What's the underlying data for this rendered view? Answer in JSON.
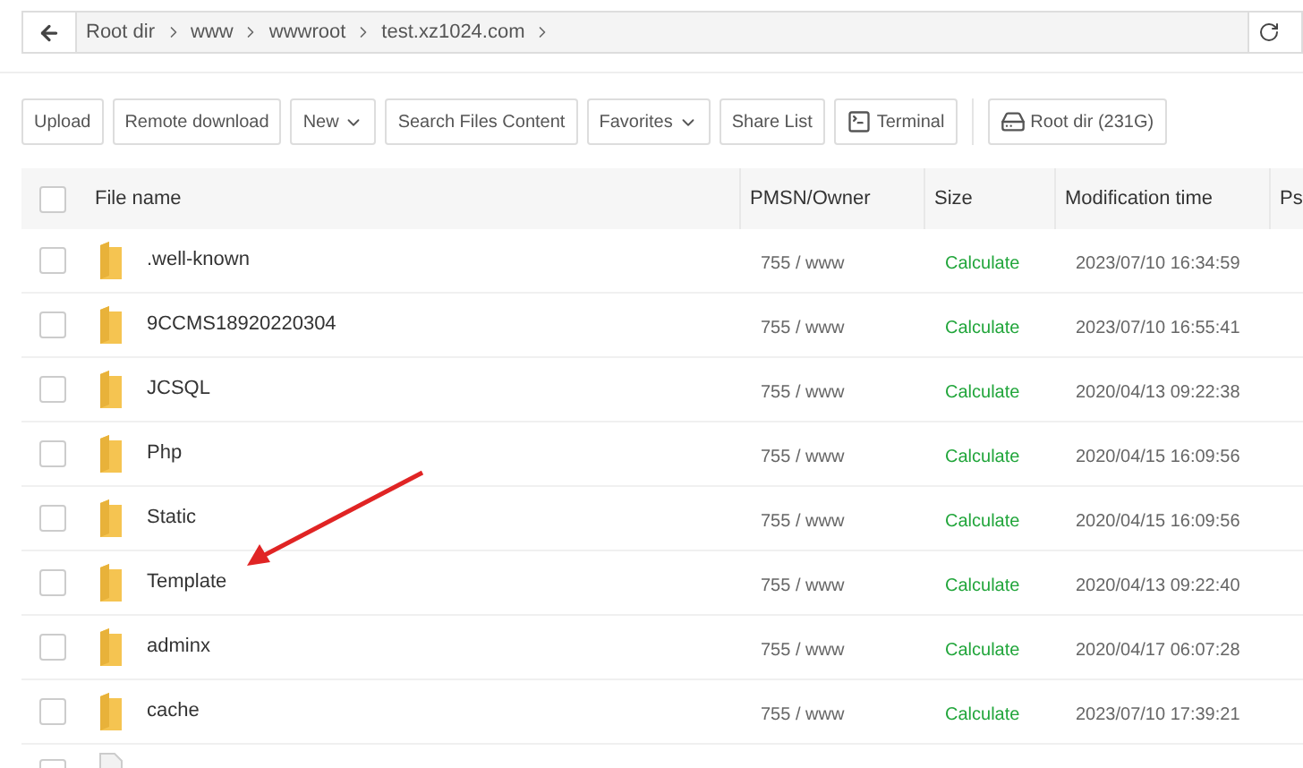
{
  "breadcrumb": [
    "Root dir",
    "www",
    "wwwroot",
    "test.xz1024.com"
  ],
  "toolbar": [
    {
      "label": "Upload",
      "kind": "plain"
    },
    {
      "label": "Remote download",
      "kind": "plain"
    },
    {
      "label": "New",
      "kind": "dropdown"
    },
    {
      "label": "Search Files Content",
      "kind": "plain"
    },
    {
      "label": "Favorites",
      "kind": "dropdown"
    },
    {
      "label": "Share List",
      "kind": "plain"
    },
    {
      "label": "Terminal",
      "kind": "terminal"
    },
    {
      "label": "Root dir (231G)",
      "kind": "disk"
    }
  ],
  "table": {
    "columns": [
      "File name",
      "PMSN/Owner",
      "Size",
      "Modification time",
      "Ps"
    ],
    "header_checked": false,
    "rows": [
      {
        "name": ".well-known",
        "owner": "755 / www",
        "size": "Calculate",
        "time": "2023/07/10 16:34:59",
        "checked": false
      },
      {
        "name": "9CCMS18920220304",
        "owner": "755 / www",
        "size": "Calculate",
        "time": "2023/07/10 16:55:41",
        "checked": false
      },
      {
        "name": "JCSQL",
        "owner": "755 / www",
        "size": "Calculate",
        "time": "2020/04/13 09:22:38",
        "checked": false
      },
      {
        "name": "Php",
        "owner": "755 / www",
        "size": "Calculate",
        "time": "2020/04/15 16:09:56",
        "checked": false
      },
      {
        "name": "Static",
        "owner": "755 / www",
        "size": "Calculate",
        "time": "2020/04/15 16:09:56",
        "checked": false
      },
      {
        "name": "Template",
        "owner": "755 / www",
        "size": "Calculate",
        "time": "2020/04/13 09:22:40",
        "checked": false
      },
      {
        "name": "adminx",
        "owner": "755 / www",
        "size": "Calculate",
        "time": "2020/04/17 06:07:28",
        "checked": false
      },
      {
        "name": "cache",
        "owner": "755 / www",
        "size": "Calculate",
        "time": "2023/07/10 17:39:21",
        "checked": false
      }
    ],
    "partial_row": {
      "checked": false
    }
  }
}
